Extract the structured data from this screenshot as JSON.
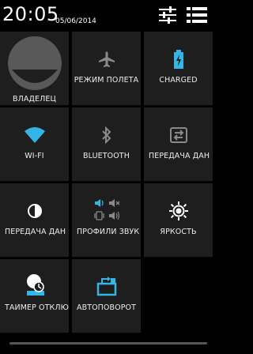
{
  "status": {
    "time": "20:05",
    "date": "05/06/2014"
  },
  "header_icons": {
    "settings": "sliders-icon",
    "notifications": "list-icon"
  },
  "tiles": [
    {
      "id": "owner",
      "label": "ВЛАДЕЛЕЦ",
      "icon": "avatar-icon"
    },
    {
      "id": "airplane",
      "label": "РЕЖИМ ПОЛЕТА",
      "icon": "airplane-icon"
    },
    {
      "id": "battery",
      "label": "CHARGED",
      "icon": "battery-charging-icon"
    },
    {
      "id": "wifi",
      "label": "WI-FI",
      "icon": "wifi-icon"
    },
    {
      "id": "bluetooth",
      "label": "BLUETOOTH",
      "icon": "bluetooth-icon"
    },
    {
      "id": "data",
      "label": "ПЕРЕДАЧА ДАН",
      "icon": "data-transfer-icon"
    },
    {
      "id": "data2",
      "label": "ПЕРЕДАЧА ДАН",
      "icon": "data-saver-icon"
    },
    {
      "id": "sound",
      "label": "ПРОФИЛИ ЗВУК",
      "icon": "sound-profiles-icon"
    },
    {
      "id": "brightness",
      "label": "ЯРКОСТЬ",
      "icon": "brightness-icon"
    },
    {
      "id": "timeout",
      "label": "ТАЙМЕР ОТКЛЮ",
      "icon": "screen-timeout-icon"
    },
    {
      "id": "rotate",
      "label": "АВТОПОВОРОТ",
      "icon": "auto-rotate-icon"
    }
  ],
  "colors": {
    "accent": "#33b5e5",
    "tile_bg": "#1e1e1e",
    "icon_dim": "#8a8a8a"
  }
}
